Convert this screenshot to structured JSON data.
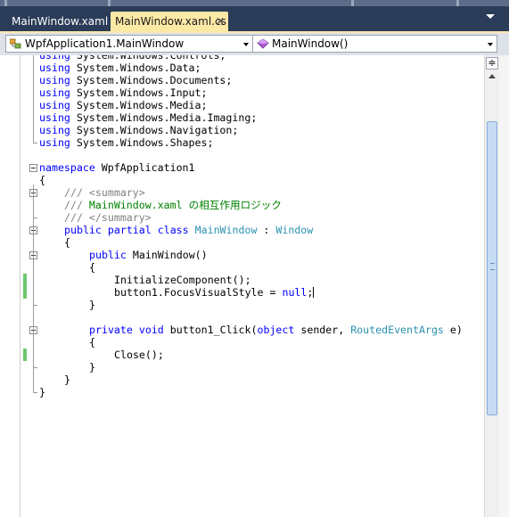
{
  "tabs": [
    {
      "label": "MainWindow.xaml",
      "active": false
    },
    {
      "label": "MainWindow.xaml.cs",
      "active": true
    }
  ],
  "tab_close_glyph": "✕",
  "navigation": {
    "type_combo": "WpfApplication1.MainWindow",
    "member_combo": "MainWindow()"
  },
  "editor": {
    "lines": [
      {
        "indent": 0,
        "tokens": [
          {
            "t": "using",
            "c": "kw"
          },
          {
            "t": " System.Windows.Controls;"
          }
        ]
      },
      {
        "indent": 0,
        "tokens": [
          {
            "t": "using",
            "c": "kw"
          },
          {
            "t": " System.Windows.Data;"
          }
        ]
      },
      {
        "indent": 0,
        "tokens": [
          {
            "t": "using",
            "c": "kw"
          },
          {
            "t": " System.Windows.Documents;"
          }
        ]
      },
      {
        "indent": 0,
        "tokens": [
          {
            "t": "using",
            "c": "kw"
          },
          {
            "t": " System.Windows.Input;"
          }
        ]
      },
      {
        "indent": 0,
        "tokens": [
          {
            "t": "using",
            "c": "kw"
          },
          {
            "t": " System.Windows.Media;"
          }
        ]
      },
      {
        "indent": 0,
        "tokens": [
          {
            "t": "using",
            "c": "kw"
          },
          {
            "t": " System.Windows.Media.Imaging;"
          }
        ]
      },
      {
        "indent": 0,
        "tokens": [
          {
            "t": "using",
            "c": "kw"
          },
          {
            "t": " System.Windows.Navigation;"
          }
        ]
      },
      {
        "indent": 0,
        "tokens": [
          {
            "t": "using",
            "c": "kw"
          },
          {
            "t": " System.Windows.Shapes;"
          }
        ]
      },
      {
        "indent": 0,
        "tokens": []
      },
      {
        "indent": 0,
        "tokens": [
          {
            "t": "namespace",
            "c": "kw"
          },
          {
            "t": " WpfApplication1"
          }
        ]
      },
      {
        "indent": 0,
        "tokens": [
          {
            "t": "{"
          }
        ]
      },
      {
        "indent": 4,
        "tokens": [
          {
            "t": "/// ",
            "c": "xd"
          },
          {
            "t": "<summary>",
            "c": "xd"
          }
        ]
      },
      {
        "indent": 4,
        "tokens": [
          {
            "t": "/// ",
            "c": "xd"
          },
          {
            "t": "MainWindow.xaml の相互作用ロジック",
            "c": "cm"
          }
        ]
      },
      {
        "indent": 4,
        "tokens": [
          {
            "t": "/// ",
            "c": "xd"
          },
          {
            "t": "</summary>",
            "c": "xd"
          }
        ]
      },
      {
        "indent": 4,
        "tokens": [
          {
            "t": "public",
            "c": "kw"
          },
          {
            "t": " "
          },
          {
            "t": "partial",
            "c": "kw"
          },
          {
            "t": " "
          },
          {
            "t": "class",
            "c": "kw"
          },
          {
            "t": " "
          },
          {
            "t": "MainWindow",
            "c": "ty"
          },
          {
            "t": " : "
          },
          {
            "t": "Window",
            "c": "ty"
          }
        ]
      },
      {
        "indent": 4,
        "tokens": [
          {
            "t": "{"
          }
        ]
      },
      {
        "indent": 8,
        "tokens": [
          {
            "t": "public",
            "c": "kw"
          },
          {
            "t": " MainWindow()"
          }
        ]
      },
      {
        "indent": 8,
        "tokens": [
          {
            "t": "{"
          }
        ]
      },
      {
        "indent": 12,
        "tokens": [
          {
            "t": "InitializeComponent();"
          }
        ]
      },
      {
        "indent": 12,
        "tokens": [
          {
            "t": "button1.FocusVisualStyle = "
          },
          {
            "t": "null",
            "c": "kw"
          },
          {
            "t": ";"
          }
        ],
        "caret": true
      },
      {
        "indent": 8,
        "tokens": [
          {
            "t": "}"
          }
        ]
      },
      {
        "indent": 0,
        "tokens": []
      },
      {
        "indent": 8,
        "tokens": [
          {
            "t": "private",
            "c": "kw"
          },
          {
            "t": " "
          },
          {
            "t": "void",
            "c": "kw"
          },
          {
            "t": " button1_Click("
          },
          {
            "t": "object",
            "c": "kw"
          },
          {
            "t": " sender, "
          },
          {
            "t": "RoutedEventArgs",
            "c": "ty"
          },
          {
            "t": " e)"
          }
        ]
      },
      {
        "indent": 8,
        "tokens": [
          {
            "t": "{"
          }
        ]
      },
      {
        "indent": 12,
        "tokens": [
          {
            "t": "Close();"
          }
        ]
      },
      {
        "indent": 8,
        "tokens": [
          {
            "t": "}"
          }
        ]
      },
      {
        "indent": 4,
        "tokens": [
          {
            "t": "}"
          }
        ]
      },
      {
        "indent": 0,
        "tokens": [
          {
            "t": "}"
          }
        ]
      }
    ],
    "changed_lines": [
      18,
      19,
      24
    ],
    "collapsible_lines": [
      9,
      11,
      14,
      16,
      22
    ]
  },
  "colors": {
    "keyword": "#0000ff",
    "type": "#2b91af",
    "comment": "#008000",
    "xml_doc": "#808080",
    "active_tab": "#fde9a6",
    "ide_background": "#2b3c59",
    "change_marker": "#6dc76d"
  },
  "icons": {
    "type_combo": "class-icon",
    "member_combo": "method-icon",
    "tab_menu": "chevron-down-icon",
    "split": "split-window-icon"
  }
}
